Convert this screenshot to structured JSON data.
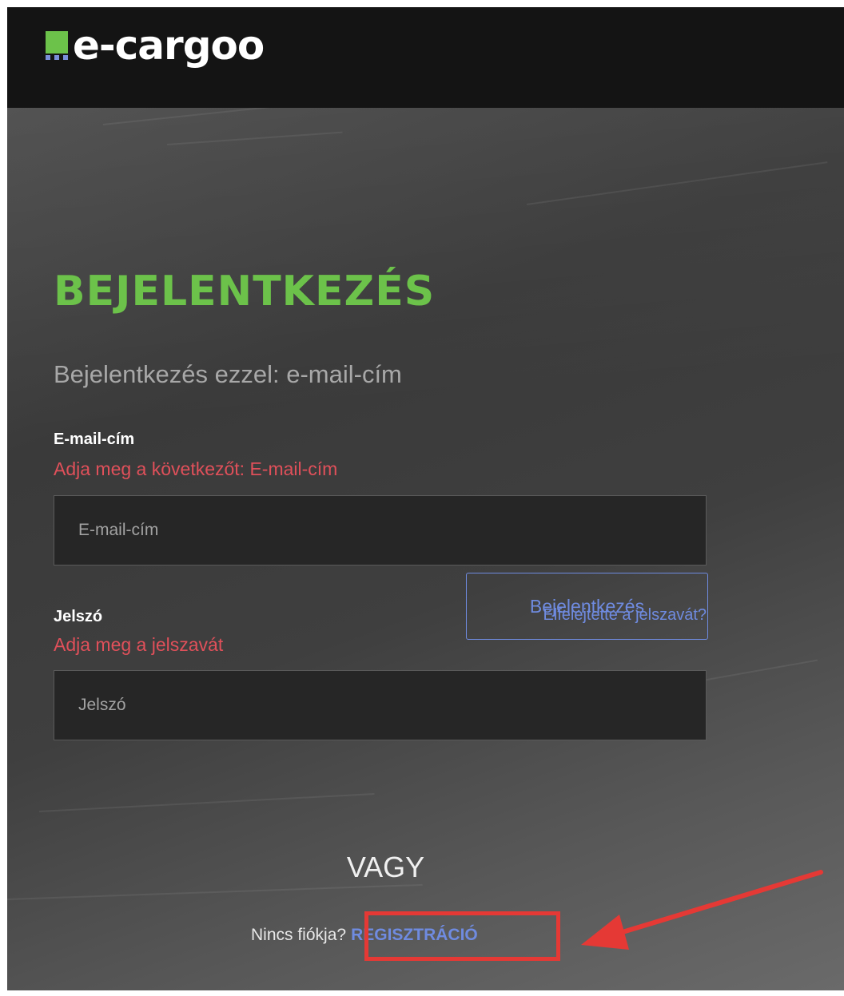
{
  "brand": {
    "name": "e-cargoo",
    "accent": "#6cc24a",
    "link_color": "#6f8be0",
    "error_color": "#e0505a"
  },
  "login": {
    "title": "BEJELENTKEZÉS",
    "subtitle": "Bejelentkezés ezzel: e-mail-cím",
    "email": {
      "label": "E-mail-cím",
      "error": "Adja meg a következőt: E-mail-cím",
      "placeholder": "E-mail-cím",
      "value": ""
    },
    "password": {
      "label": "Jelszó",
      "error": "Adja meg a jelszavát",
      "placeholder": "Jelszó",
      "value": ""
    },
    "forgot_label": "Elfelejtette a jelszavát?",
    "submit_label": "Bejelentkezés",
    "or_label": "VAGY",
    "no_account_text": "Nincs fiókja?",
    "signup_label": "REGISZTRÁCIÓ"
  },
  "annotation": {
    "color": "#e53935",
    "target": "signup-link",
    "icon": "arrow-icon"
  }
}
